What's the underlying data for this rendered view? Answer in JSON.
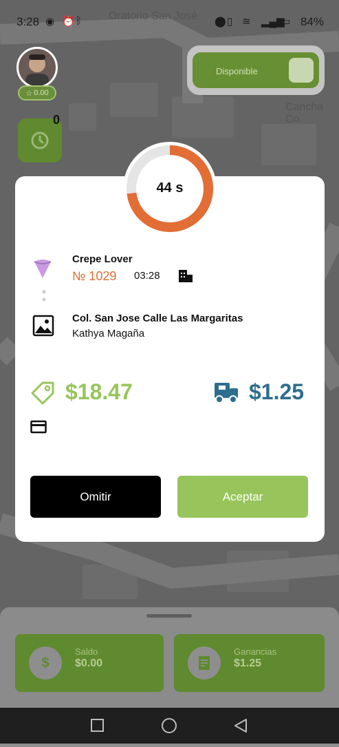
{
  "status_bar": {
    "time": "3:28",
    "battery": "84%"
  },
  "map": {
    "labels": [
      "Oratorio San José",
      "Cancha Co"
    ]
  },
  "driver": {
    "rating": "0.00",
    "history_count": "0"
  },
  "availability": {
    "label": "Disponible"
  },
  "timer": {
    "text": "44 s",
    "fraction_remaining": 0.73
  },
  "order": {
    "store_name": "Crepe Lover",
    "number": "№ 1029",
    "time": "03:28",
    "address": "Col. San Jose Calle Las Margaritas",
    "customer": "Kathya Magaña",
    "price": "$18.47",
    "delivery_fee": "$1.25"
  },
  "actions": {
    "skip": "Omitir",
    "accept": "Aceptar"
  },
  "bottom_panel": {
    "balance_label": "Saldo",
    "balance_value": "$0.00",
    "earnings_label": "Ganancias",
    "earnings_value": "$1.25"
  },
  "colors": {
    "accent_green": "#97c55b",
    "orange": "#e26d35",
    "blue": "#2e6d8e",
    "dark_green": "#5f8a2f"
  },
  "icons": [
    "store-icon",
    "building-icon",
    "image-icon",
    "tag-icon",
    "truck-icon",
    "card-icon",
    "history-icon",
    "star-icon",
    "dollar-icon",
    "receipt-icon"
  ]
}
